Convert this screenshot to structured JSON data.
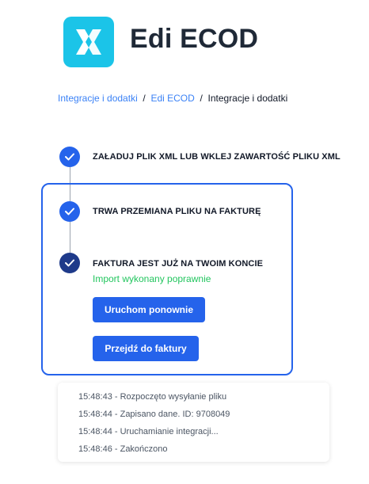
{
  "header": {
    "title": "Edi ECOD",
    "logo_icon": "ecod-logo-icon",
    "logo_color": "#1bc4e8"
  },
  "breadcrumb": {
    "items": [
      "Integracje i dodatki",
      "Edi ECOD",
      "Integracje i dodatki"
    ],
    "separator": "/"
  },
  "steps": [
    {
      "label": "ZAŁADUJ PLIK XML LUB WKLEJ ZAWARTOŚĆ PLIKU XML",
      "status": "done",
      "icon": "check-icon"
    },
    {
      "label": "TRWA PRZEMIANA PLIKU NA FAKTURĘ",
      "status": "done",
      "icon": "check-icon"
    },
    {
      "label": "FAKTURA JEST JUŻ NA TWOIM KONCIE",
      "status": "current",
      "icon": "check-icon"
    }
  ],
  "result": {
    "message": "Import wykonany poprawnie",
    "restart_label": "Uruchom ponownie",
    "goto_invoice_label": "Przejdź do faktury"
  },
  "log": [
    "15:48:43 - Rozpoczęto wysyłanie pliku",
    "15:48:44 - Zapisano dane. ID: 9708049",
    "15:48:44 - Uruchamianie integracji...",
    "15:48:46 - Zakończono"
  ],
  "colors": {
    "accent": "#2563eb",
    "accent_dark": "#1e3a8a",
    "success": "#22c55e",
    "link": "#3b82f6"
  }
}
